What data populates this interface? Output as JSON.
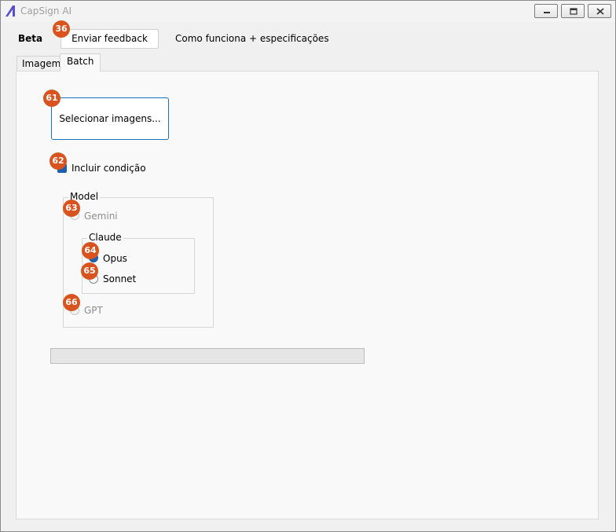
{
  "window": {
    "title": "CapSign AI",
    "icon": "capsign-logo-icon",
    "controls": [
      "minimize-icon",
      "restore-icon",
      "close-icon"
    ]
  },
  "header": {
    "beta_label": "Beta",
    "feedback_button": "Enviar feedback",
    "how_it_works_link": "Como funciona + especificações"
  },
  "tabs": [
    {
      "label": "Imagem",
      "selected": false
    },
    {
      "label": "Batch",
      "selected": true
    }
  ],
  "batch": {
    "select_images_button": "Selecionar imagens...",
    "include_condition": {
      "label": "Incluir condição",
      "checked": true
    },
    "model_group": {
      "title": "Model",
      "options": {
        "gemini": {
          "label": "Gemini",
          "enabled": false,
          "checked": false
        },
        "claude": {
          "title": "Claude",
          "opus": {
            "label": "Opus",
            "checked": true
          },
          "sonnet": {
            "label": "Sonnet",
            "checked": false
          }
        },
        "gpt": {
          "label": "GPT",
          "enabled": false,
          "checked": false
        }
      }
    },
    "progress": {
      "value": 0
    }
  },
  "annotations": [
    "36",
    "61",
    "62",
    "63",
    "64",
    "65",
    "66"
  ],
  "colors": {
    "accent": "#1f5fb0",
    "badge": "#d9531e",
    "panel": "#f9f9f9",
    "window": "#f0f0f0"
  }
}
